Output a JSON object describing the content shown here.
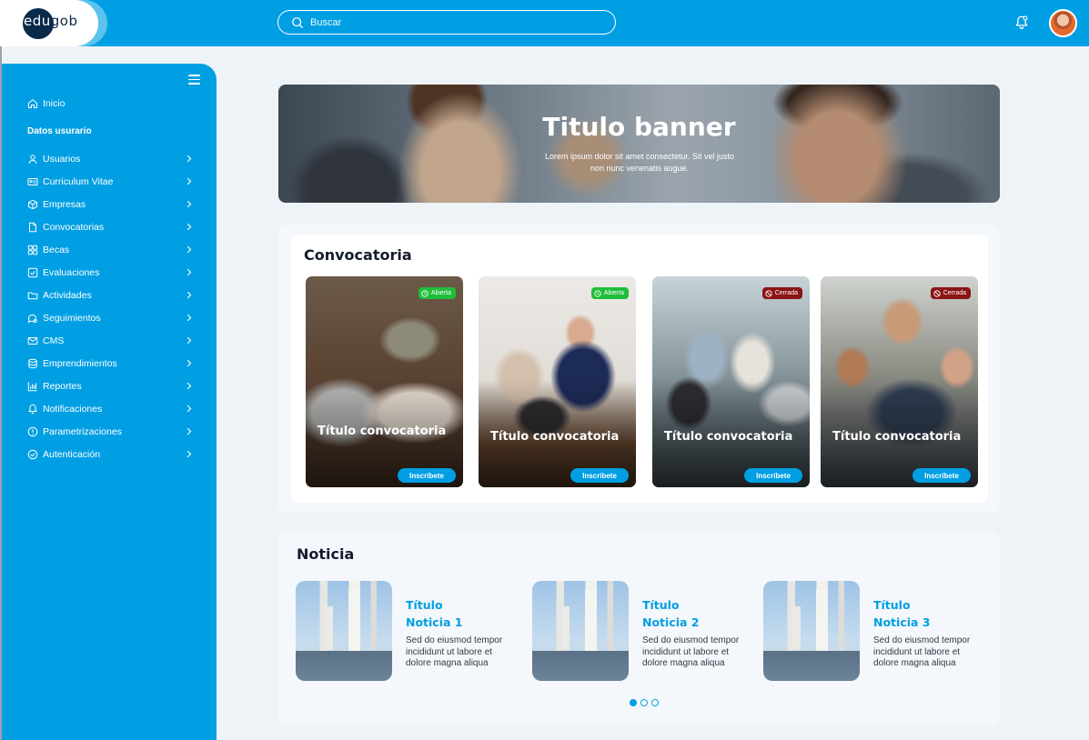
{
  "header": {
    "logo_text_a": "edu",
    "logo_text_b": "gob",
    "search_placeholder": "Buscar"
  },
  "sidebar": {
    "home_label": "Inicio",
    "section_label": "Datos usurario",
    "items": [
      {
        "label": "Usuarios",
        "icon": "user-icon"
      },
      {
        "label": "Curriculum Vitae",
        "icon": "id-card-icon"
      },
      {
        "label": "Empresas",
        "icon": "box-icon"
      },
      {
        "label": "Convocatorias",
        "icon": "document-icon"
      },
      {
        "label": "Becas",
        "icon": "grid-icon"
      },
      {
        "label": "Evaluaciones",
        "icon": "checkbox-icon"
      },
      {
        "label": "Actividades",
        "icon": "folder-icon"
      },
      {
        "label": "Seguimientos",
        "icon": "chat-icon"
      },
      {
        "label": "CMS",
        "icon": "mail-icon"
      },
      {
        "label": "Emprendimientos",
        "icon": "database-icon"
      },
      {
        "label": "Reportes",
        "icon": "chart-icon"
      },
      {
        "label": "Notificaciones",
        "icon": "bell-icon"
      },
      {
        "label": "Parametrizaciones",
        "icon": "info-icon"
      },
      {
        "label": "Autenticación",
        "icon": "check-circle-icon"
      }
    ]
  },
  "banner": {
    "title": "Titulo banner",
    "subtitle": "Lorem ipsum dolor sit amet consectetur. Sit vel justo non nunc venenatis augue."
  },
  "convocatoria": {
    "title": "Convocatoria",
    "cards": [
      {
        "status": "Abierta",
        "status_type": "open",
        "title": "Título convocatoria",
        "button": "Inscríbete"
      },
      {
        "status": "Abierta",
        "status_type": "open",
        "title": "Título convocatoria",
        "button": "Inscríbete"
      },
      {
        "status": "Cerrada",
        "status_type": "closed",
        "title": "Título convocatoria",
        "button": "Inscríbete"
      },
      {
        "status": "Cerrada",
        "status_type": "closed",
        "title": "Título convocatoria",
        "button": "Inscríbete"
      }
    ]
  },
  "noticia": {
    "title": "Noticia",
    "items": [
      {
        "title_line1": "Título",
        "title_line2": "Noticia 1",
        "body": "Sed do eiusmod tempor incididunt ut labore et dolore magna aliqua"
      },
      {
        "title_line1": "Título",
        "title_line2": "Noticia 2",
        "body": "Sed do eiusmod tempor incididunt ut labore et dolore magna aliqua"
      },
      {
        "title_line1": "Título",
        "title_line2": "Noticia 3",
        "body": "Sed do eiusmod tempor incididunt ut labore et dolore magna aliqua"
      }
    ],
    "carousel_pages": 3,
    "carousel_active": 1
  },
  "colors": {
    "primary": "#009fe3",
    "open": "#1fbe3a",
    "closed": "#8b1414",
    "dark": "#0b2a4a"
  }
}
